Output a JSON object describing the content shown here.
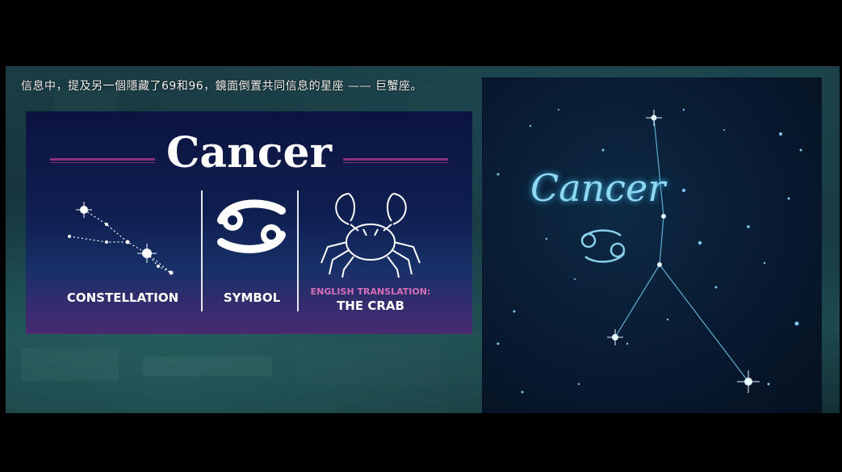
{
  "subtitle": "信息中，提及另一個隱藏了69和96，鏡面倒置共同信息的星座 —— 巨蟹座。",
  "card": {
    "title": "Cancer",
    "constellation_label": "CONSTELLATION",
    "symbol_label": "SYMBOL",
    "translation_heading": "ENGLISH TRANSLATION:",
    "translation_value": "THE CRAB",
    "symbol_glyph": "♋",
    "accent_color": "#8b2f7a",
    "translation_heading_color": "#d66fb8"
  },
  "right_panel": {
    "title": "Cancer",
    "symbol_glyph": "♋",
    "glow_color": "#8fd9f5"
  }
}
